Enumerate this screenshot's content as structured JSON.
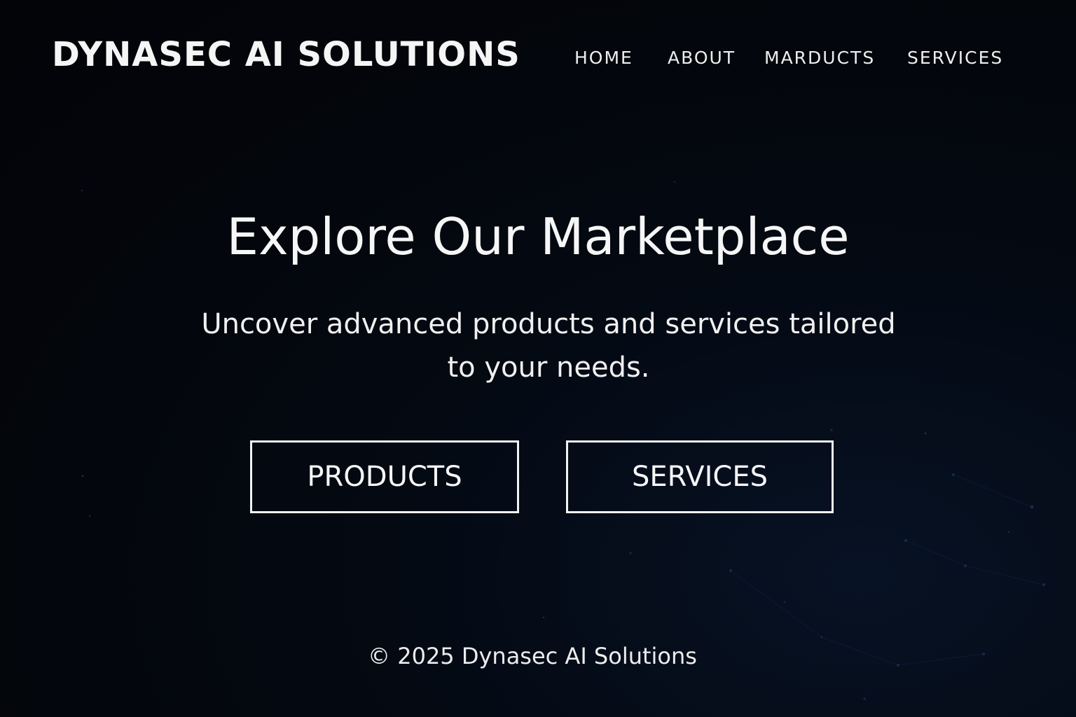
{
  "header": {
    "brand": "DYNASEC AI SOLUTIONS",
    "nav": [
      {
        "label": "HOME"
      },
      {
        "label": "ABOUT"
      },
      {
        "label": "MARDUCTS"
      },
      {
        "label": "SERVICES"
      }
    ]
  },
  "hero": {
    "title": "Explore Our Marketplace",
    "subtitle": "Uncover advanced products and services tailored to your needs.",
    "buttons": {
      "products": "PRODUCTS",
      "services": "SERVICES"
    }
  },
  "footer": {
    "copyright": "© 2025 Dynasec AI Solutions"
  },
  "colors": {
    "background": "#03060c",
    "text": "#f4f4f4",
    "accent_glow": "#0c2a52"
  }
}
